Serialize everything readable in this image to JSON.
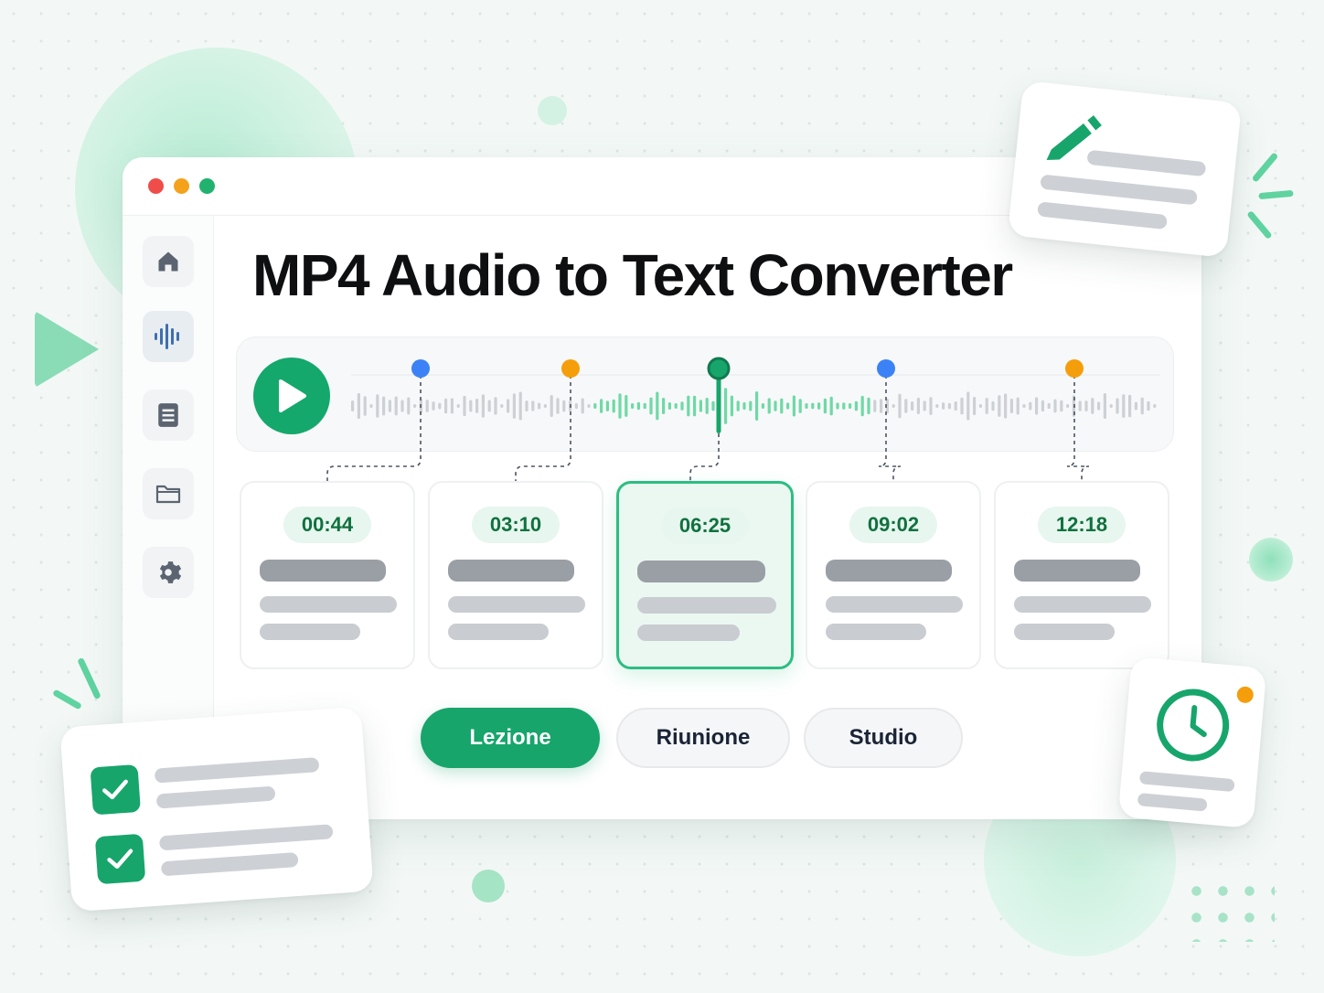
{
  "window": {
    "controls": {
      "close": "#ef4d4a",
      "minimize": "#f4a21c",
      "maximize": "#20b26e"
    }
  },
  "sidebar": {
    "items": [
      {
        "icon": "home-icon"
      },
      {
        "icon": "audio-wave-icon",
        "active": true
      },
      {
        "icon": "document-icon"
      },
      {
        "icon": "folder-icon"
      },
      {
        "icon": "gear-icon"
      }
    ]
  },
  "main": {
    "title": "MP4 Audio to Text Converter"
  },
  "player": {
    "play_icon": "play-icon",
    "markers": [
      {
        "color": "#3b82f6"
      },
      {
        "color": "#f59e0b"
      },
      {
        "color": "#17a56b"
      },
      {
        "color": "#3b82f6"
      },
      {
        "color": "#f59e0b"
      }
    ]
  },
  "segments": [
    {
      "timestamp": "00:44"
    },
    {
      "timestamp": "03:10"
    },
    {
      "timestamp": "06:25",
      "active": true
    },
    {
      "timestamp": "09:02"
    },
    {
      "timestamp": "12:18"
    }
  ],
  "categories": {
    "items": [
      {
        "label": "Lezione",
        "selected": true
      },
      {
        "label": "Riunione",
        "selected": false
      },
      {
        "label": "Studio",
        "selected": false
      }
    ]
  },
  "decor": {
    "edit_icon": "pencil-icon",
    "clock_icon": "clock-icon",
    "check_icon": "checkmark-icon"
  },
  "colors": {
    "accent": "#17a56b",
    "accent_light": "#e7f6ee",
    "wave_gray": "#cdd0d4",
    "wave_green": "#6fd9a6"
  }
}
